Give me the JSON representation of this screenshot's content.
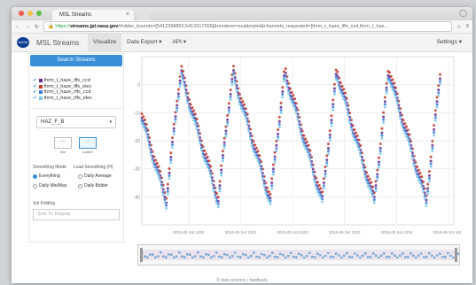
{
  "browser": {
    "tab_title": "MSL Streams",
    "url_scheme": "https://",
    "url_host": "streams.jpl.nasa.gov",
    "url_path": "/#slider_bounds=[5412398855,5412917655]&renderer=scatterplot&channels_requested=[thrm_t_haze_iffs_ccd,thrm_t_haz..."
  },
  "app": {
    "logo_text": "NASA",
    "brand": "MSL Streams",
    "nav": [
      "Visualize",
      "Data Export ▾",
      "API ▾"
    ],
    "settings": "Settings ▾"
  },
  "sidebar": {
    "search_button": "Search Streams",
    "channels": [
      {
        "label": "thrm_t_haze_iffs_ccd",
        "color": "#6a2c8a"
      },
      {
        "label": "thrm_t_haze_iffs_elec",
        "color": "#c0392b"
      },
      {
        "label": "thrm_t_haze_rffs_ccd",
        "color": "#3a7bd5"
      },
      {
        "label": "thrm_t_haze_rffs_elec",
        "color": "#7ec8e8"
      }
    ],
    "instrument_select": "HAZ_F_B",
    "render_modes": [
      {
        "label": "line",
        "glyph": "〰"
      },
      {
        "label": "scatter",
        "glyph": "⁘"
      }
    ],
    "smoothing_label": "Smoothing Mode",
    "smoothing_status": "Load Smoothing (H)",
    "smoothing_options": [
      "Everything",
      "Daily Average",
      "Daily Min/Max",
      "Daily Bidder"
    ],
    "sol_folding_label": "Sol Folding",
    "sol_placeholder": "Sols To Display"
  },
  "chart_data": {
    "type": "scatter",
    "title": "",
    "xlabel": "",
    "ylabel": "",
    "ylim": [
      -50,
      10
    ],
    "y_ticks": [
      -40,
      -30,
      -20,
      -10,
      0
    ],
    "x_ticks": [
      "2015-05 Sol 1000",
      "2015-05 Sol 1001",
      "2015-05 Sol 1002",
      "2015-05 Sol 1003",
      "2015-05 Sol 1004",
      "2015-05 Sol 1005"
    ],
    "sols": 6,
    "grid": true,
    "series": [
      {
        "name": "thrm_t_haze_iffs_ccd",
        "color": "#6a2c8a",
        "offset": 0
      },
      {
        "name": "thrm_t_haze_iffs_elec",
        "color": "#c0392b",
        "offset": 1.5
      },
      {
        "name": "thrm_t_haze_rffs_ccd",
        "color": "#3a7bd5",
        "offset": -1
      },
      {
        "name": "thrm_t_haze_rffs_elec",
        "color": "#7ec8e8",
        "offset": -2
      }
    ]
  },
  "footer": "© data science | feedback"
}
